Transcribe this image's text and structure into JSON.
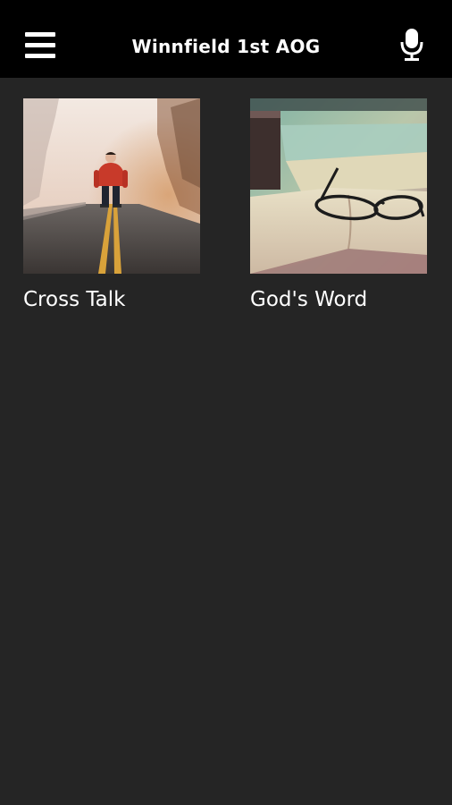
{
  "header": {
    "title": "Winnfield 1st AOG",
    "menu_icon": "hamburger-menu-icon",
    "mic_icon": "microphone-icon"
  },
  "items": [
    {
      "label": "Cross Talk",
      "image": "man-on-foggy-road-photo"
    },
    {
      "label": "God's Word",
      "image": "open-bible-with-glasses-photo"
    }
  ],
  "colors": {
    "header_bg": "#000000",
    "page_bg": "#252525",
    "text": "#ffffff"
  }
}
